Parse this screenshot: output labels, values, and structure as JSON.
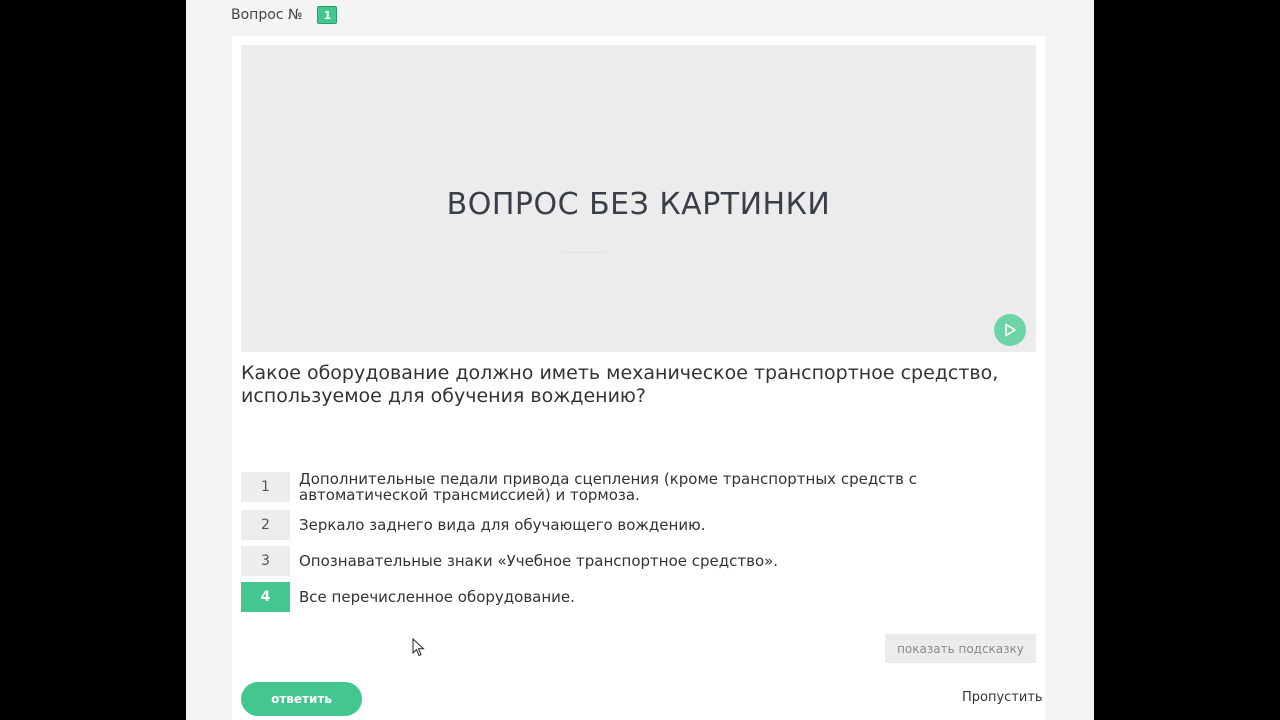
{
  "header": {
    "question_label": "Вопрос №",
    "question_number": "1"
  },
  "image": {
    "placeholder_text": "ВОПРОС БЕЗ КАРТИНКИ",
    "play_icon": "play-icon"
  },
  "question": {
    "text": "Какое оборудование должно иметь механическое транспортное средство, используемое для обучения вождению?"
  },
  "answers": [
    {
      "num": "1",
      "text": "Дополнительные педали привода сцепления (кроме транспортных средств с автоматической трансмиссией) и тормоза."
    },
    {
      "num": "2",
      "text": "Зеркало заднего вида для обучающего вождению."
    },
    {
      "num": "3",
      "text": "Опознавательные знаки «Учебное транспортное средство»."
    },
    {
      "num": "4",
      "text": "Все перечисленное оборудование.",
      "selected": true
    }
  ],
  "buttons": {
    "hint_label": "показать подсказку",
    "answer_label": "ответить",
    "skip_label": "Пропустить"
  },
  "colors": {
    "accent": "#44c78f",
    "play_button": "#6fd3a8",
    "background_outer": "#000000",
    "page_background": "#f4f4f4"
  }
}
